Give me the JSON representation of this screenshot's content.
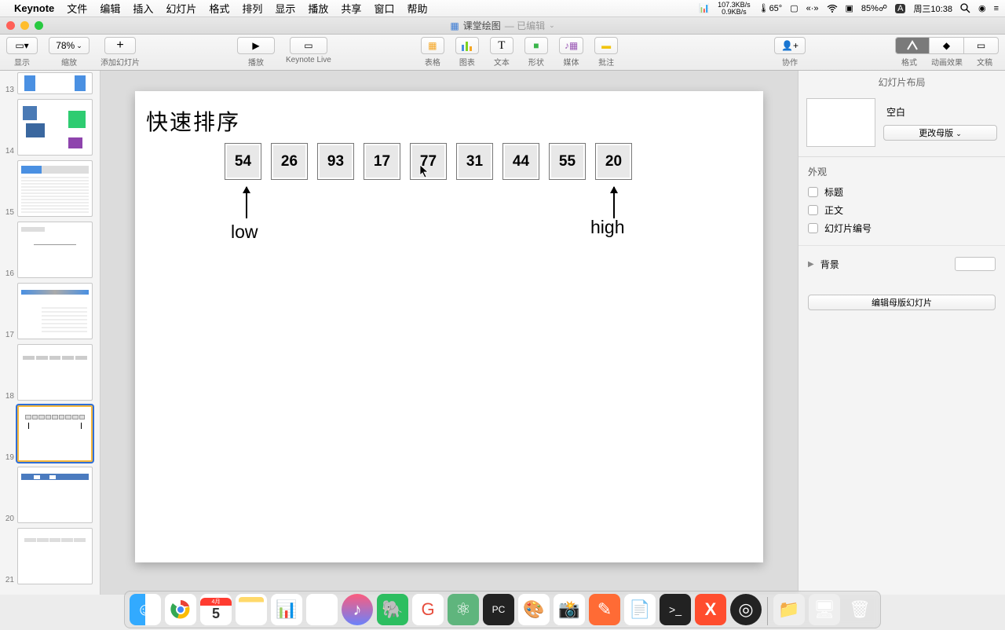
{
  "menubar": {
    "app": "Keynote",
    "items": [
      "文件",
      "编辑",
      "插入",
      "幻灯片",
      "格式",
      "排列",
      "显示",
      "播放",
      "共享",
      "窗口",
      "帮助"
    ],
    "status": {
      "net_up": "107.3KB/s",
      "net_down": "0.9KB/s",
      "temp": "65°",
      "battery": "85%",
      "clock": "周三10:38"
    }
  },
  "window": {
    "doc_title": "课堂绘图",
    "edited": "— 已编辑"
  },
  "toolbar": {
    "view": "显示",
    "zoom_value": "78%",
    "zoom_label": "缩放",
    "add_slide": "添加幻灯片",
    "play": "播放",
    "keynote_live": "Keynote Live",
    "table": "表格",
    "chart": "图表",
    "text": "文本",
    "shape": "形状",
    "media": "媒体",
    "comment": "批注",
    "collab": "协作",
    "format": "格式",
    "animate": "动画效果",
    "document": "文稿"
  },
  "thumbnails": {
    "numbers": [
      "13",
      "14",
      "15",
      "16",
      "17",
      "18",
      "19",
      "20",
      "21"
    ],
    "selected_index": 6
  },
  "slide": {
    "title": "快速排序",
    "values": [
      "54",
      "26",
      "93",
      "17",
      "77",
      "31",
      "44",
      "55",
      "20"
    ],
    "low_label": "low",
    "high_label": "high"
  },
  "inspector": {
    "header": "幻灯片布局",
    "layout_name": "空白",
    "change_master": "更改母版",
    "appearance": "外观",
    "chk_title": "标题",
    "chk_body": "正文",
    "chk_number": "幻灯片编号",
    "background": "背景",
    "edit_master": "编辑母版幻灯片"
  },
  "dock": {
    "apps": [
      "finder",
      "chrome",
      "calendar",
      "notes",
      "numbers",
      "weather",
      "itunes",
      "evernote",
      "wps",
      "atom",
      "pycharm",
      "paint",
      "screenshot",
      "cleanmymac",
      "textedit",
      "terminal",
      "xmind",
      "obs"
    ],
    "right": [
      "folder",
      "app",
      "trash"
    ]
  }
}
